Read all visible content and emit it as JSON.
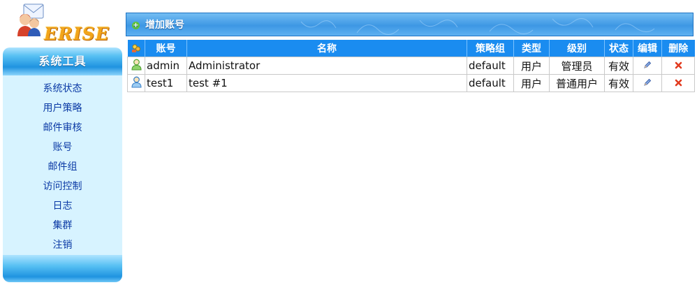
{
  "brand": {
    "logo_text": "ERISE"
  },
  "sidebar": {
    "title": "系统工具",
    "items": [
      {
        "label": "系统状态"
      },
      {
        "label": "用户策略"
      },
      {
        "label": "邮件审核"
      },
      {
        "label": "账号"
      },
      {
        "label": "邮件组"
      },
      {
        "label": "访问控制"
      },
      {
        "label": "日志"
      },
      {
        "label": "集群"
      },
      {
        "label": "注销"
      }
    ]
  },
  "toolbar": {
    "add_label": "增加账号",
    "add_icon": "plus-icon"
  },
  "table": {
    "header_icon": "users-config-icon",
    "columns": [
      "账号",
      "名称",
      "策略组",
      "类型",
      "级别",
      "状态",
      "编辑",
      "删除"
    ],
    "rows": [
      {
        "account": "admin",
        "name": "Administrator",
        "group": "default",
        "type": "用户",
        "level": "管理员",
        "status": "有效",
        "user_icon": "user-green-icon"
      },
      {
        "account": "test1",
        "name": "test #1",
        "group": "default",
        "type": "用户",
        "level": "普通用户",
        "status": "有效",
        "user_icon": "user-blue-icon"
      }
    ]
  },
  "colors": {
    "accent": "#1a8cf0",
    "sidebar_bg": "#d7f3ff",
    "link": "#0b3aa5"
  }
}
